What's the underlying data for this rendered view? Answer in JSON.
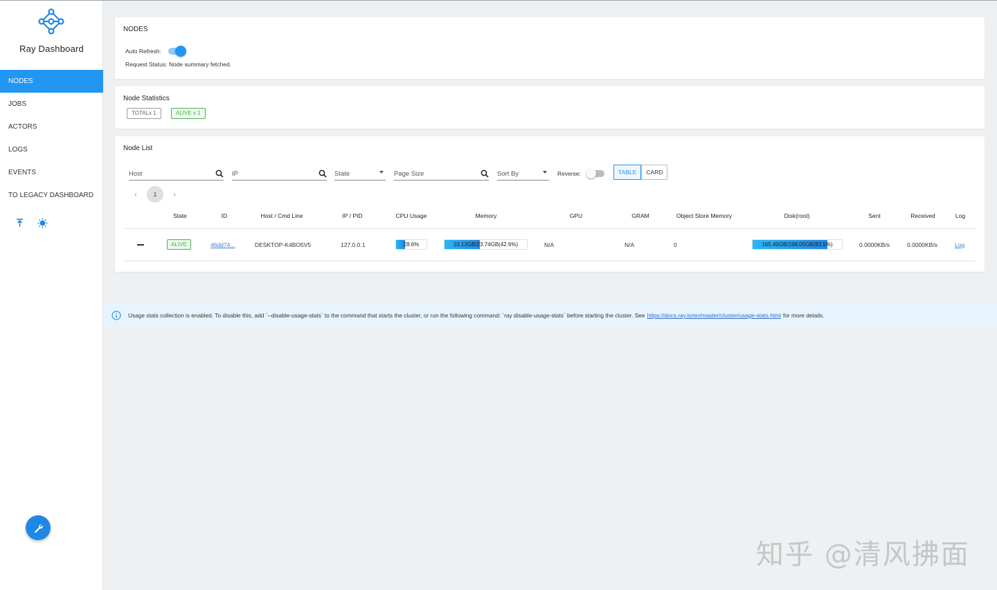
{
  "app": {
    "title": "Ray Dashboard"
  },
  "sidebar": {
    "items": [
      {
        "label": "NODES",
        "active": true
      },
      {
        "label": "JOBS"
      },
      {
        "label": "ACTORS"
      },
      {
        "label": "LOGS"
      },
      {
        "label": "EVENTS"
      },
      {
        "label": "TO LEGACY DASHBOARD"
      }
    ],
    "icons": [
      "vertical-align-top-icon",
      "brightness-icon"
    ],
    "fab_icon": "wrench-icon"
  },
  "nodes_card": {
    "title": "NODES",
    "auto_refresh_label": "Auto Refresh:",
    "auto_refresh_on": true,
    "request_status": "Request Status: Node summary fetched."
  },
  "stats_card": {
    "title": "Node Statistics",
    "total_chip": "TOTALx 1",
    "alive_chip": "ALIVE x 1"
  },
  "list_card": {
    "title": "Node List",
    "filters": {
      "host_placeholder": "Host",
      "ip_placeholder": "IP",
      "state_placeholder": "State",
      "page_size_placeholder": "Page Size",
      "sort_by_placeholder": "Sort By",
      "reverse_label": "Reverse:",
      "reverse_on": false
    },
    "view_buttons": {
      "table": "TABLE",
      "card": "CARD",
      "selected": "TABLE"
    },
    "pager": {
      "prev": "‹",
      "current": "1",
      "next": "›"
    },
    "columns": [
      "State",
      "ID",
      "Host / Cmd Line",
      "IP / PID",
      "CPU Usage",
      "Memory",
      "GPU",
      "GRAM",
      "Object Store Memory",
      "Disk(root)",
      "Sent",
      "Received",
      "Log"
    ],
    "rows": [
      {
        "state": "ALIVE",
        "id": "46dd74...",
        "host": "DESKTOP-K4BO5V5",
        "ip": "127.0.0.1",
        "cpu_text": "28.6%",
        "cpu_percent": 28.6,
        "memory_text": "10.12GB/23.74GB(42.6%)",
        "memory_percent": 42.6,
        "gpu": "N/A",
        "gram": "N/A",
        "object_store": "0",
        "disk_text": "165.40GB/198.05GB(83.5%)",
        "disk_percent": 83.5,
        "sent": "0.0000KB/s",
        "received": "0.0000KB/s",
        "log": "Log"
      }
    ]
  },
  "banner": {
    "icon": "info-icon",
    "text_before": "Usage stats collection is enabled. To disable this, add `--disable-usage-stats` to the command that starts the cluster, or run the following command: `ray disable-usage-stats` before starting the cluster. See",
    "link": "https://docs.ray.io/en/master/cluster/usage-stats.html",
    "text_after": "for more details."
  },
  "watermark": "知乎 @清风拂面",
  "colors": {
    "accent": "#2196f3",
    "alive": "#4caf50",
    "banner_bg": "#e8f4fd"
  }
}
